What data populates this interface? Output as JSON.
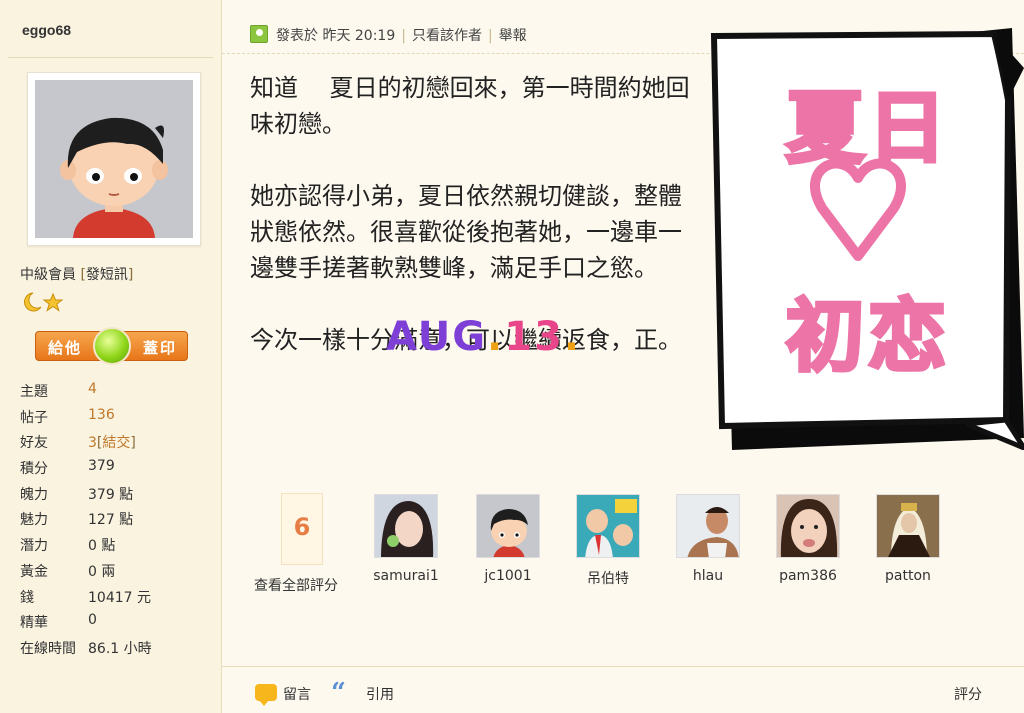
{
  "sidebar": {
    "username": "eggo68",
    "rank": "中級會員",
    "pm_link": "發短訊",
    "gift_left": "給他",
    "gift_right": "蓋印",
    "stats": [
      {
        "label": "主題",
        "value": "4"
      },
      {
        "label": "帖子",
        "value": "136"
      },
      {
        "label": "好友",
        "value": "3",
        "extra": "結交"
      },
      {
        "label": "積分",
        "value": "379"
      },
      {
        "label": "魄力",
        "value": "379 點"
      },
      {
        "label": "魅力",
        "value": "127 點"
      },
      {
        "label": "潛力",
        "value": "0 點"
      },
      {
        "label": "黃金",
        "value": "0 兩"
      },
      {
        "label": "錢",
        "value": "10417 元"
      },
      {
        "label": "精華",
        "value": "0"
      },
      {
        "label": "在線時間",
        "value": "86.1 小時"
      }
    ]
  },
  "post": {
    "posted_label": "發表於",
    "posted_time": "昨天 20:19",
    "only_author": "只看該作者",
    "report": "舉報",
    "paragraphs": [
      "知道　 夏日的初戀回來，第一時間約她回味初戀。",
      "她亦認得小弟，夏日依然親切健談，整體狀態依然。很喜歡從後抱著她，一邊車一邊雙手搓著軟熟雙峰，滿足手口之慾。",
      "今次一樣十分滿意，可以繼續返食，正。"
    ],
    "stamp": {
      "aug": "AUG",
      "dot1": ".",
      "day": "13",
      "dot2": "."
    },
    "sticker": {
      "line1": "夏日",
      "line3": "初恋"
    }
  },
  "ratings": {
    "count": "6",
    "view_all": "查看全部評分",
    "raters": [
      {
        "name": "samurai1"
      },
      {
        "name": "jc1001"
      },
      {
        "name": "吊伯特"
      },
      {
        "name": "hlau"
      },
      {
        "name": "pam386"
      },
      {
        "name": "patton"
      }
    ]
  },
  "footer": {
    "comment": "留言",
    "quote": "引用",
    "rate": "評分"
  }
}
